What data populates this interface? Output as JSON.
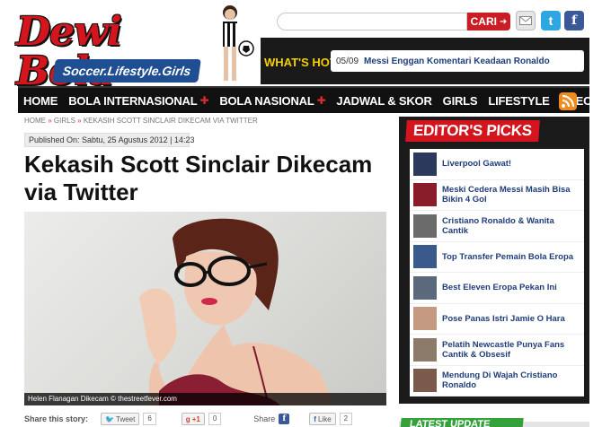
{
  "brand": {
    "name": "Dewi Bola",
    "tagline": "Soccer.Lifestyle.Girls"
  },
  "header": {
    "search_button": "CARI",
    "search_placeholder": "",
    "hot_label": "WHAT'S HOT!",
    "hot_date": "05/09",
    "hot_headline": "Messi Enggan Komentari Keadaan Ronaldo"
  },
  "nav": {
    "items": [
      {
        "label": "HOME",
        "has_sub": false
      },
      {
        "label": "BOLA INTERNASIONAL",
        "has_sub": true
      },
      {
        "label": "BOLA NASIONAL",
        "has_sub": true
      },
      {
        "label": "JADWAL & SKOR",
        "has_sub": false
      },
      {
        "label": "GIRLS",
        "has_sub": false
      },
      {
        "label": "LIFESTYLE",
        "has_sub": false
      },
      {
        "label": "SPECIALS",
        "has_sub": true
      }
    ]
  },
  "breadcrumb": {
    "home": "HOME",
    "section": "GIRLS",
    "current": "KEKASIH SCOTT SINCLAIR DIKECAM VIA TWITTER"
  },
  "article": {
    "published": "Published On: Sabtu, 25 Agustus 2012 | 14:23",
    "title": "Kekasih Scott Sinclair Dikecam via Twitter",
    "photo_caption": "Helen Flanagan Dikecam © thestreetfever.com"
  },
  "share": {
    "label": "Share this story:",
    "tweet_label": "Tweet",
    "tweet_count": "6",
    "gplus_label": "+1",
    "gplus_count": "0",
    "share_text": "Share",
    "like_label": "Like",
    "like_count": "2"
  },
  "sidebar": {
    "editors_picks_title": "EDITOR'S PICKS",
    "picks": [
      {
        "title": "Liverpool Gawat!",
        "thumb_color": "#2b3a5c"
      },
      {
        "title": "Meski Cedera Messi Masih Bisa Bikin 4 Gol",
        "thumb_color": "#8a1d2a"
      },
      {
        "title": "Cristiano Ronaldo & Wanita Cantik",
        "thumb_color": "#6b6b6b"
      },
      {
        "title": "Top Transfer Pemain Bola Eropa",
        "thumb_color": "#3a5a8c"
      },
      {
        "title": "Best Eleven Eropa Pekan Ini",
        "thumb_color": "#5a6a7c"
      },
      {
        "title": "Pose Panas Istri Jamie O Hara",
        "thumb_color": "#c49a82"
      },
      {
        "title": "Pelatih Newcastle Punya Fans Cantik & Obsesif",
        "thumb_color": "#8c7a6a"
      },
      {
        "title": "Mendung Di Wajah Cristiano Ronaldo",
        "thumb_color": "#7a5a4a"
      }
    ],
    "latest_update_title": "LATEST UPDATE"
  },
  "colors": {
    "brand_red": "#d4151e",
    "nav_bg": "#111111",
    "link_blue": "#1f3d7a",
    "hot_yellow": "#f3d000",
    "latest_green": "#35a13a"
  }
}
